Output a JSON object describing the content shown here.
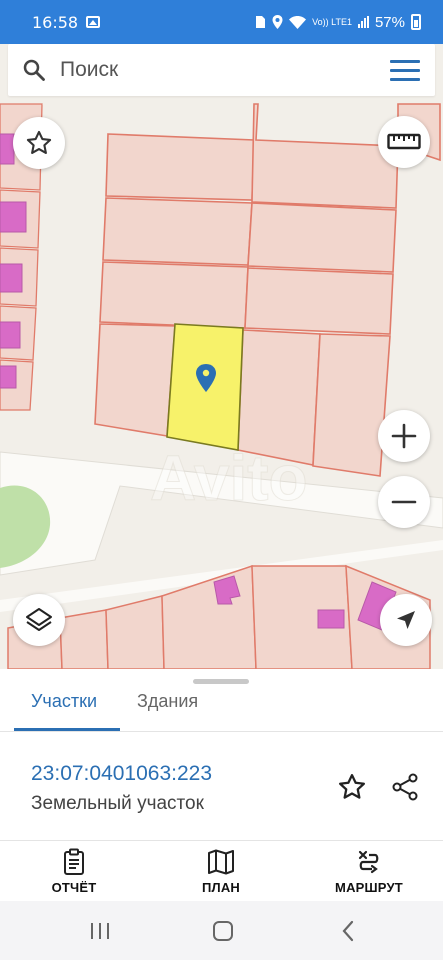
{
  "status_bar": {
    "time": "16:58",
    "network": "Vo)) LTE1",
    "battery": "57%"
  },
  "search": {
    "placeholder": "Поиск"
  },
  "map": {
    "watermark": "Avito",
    "colors": {
      "land": "#f2efe9",
      "plot_fill": "#f2d6cd",
      "plot_border": "#e07b6a",
      "selected_plot": "#f7f26a",
      "building": "#d86bc6",
      "green_area": "#bfe0a8",
      "road": "#fbfaf7",
      "marker": "#2b6fb3"
    },
    "icons": [
      "star-icon",
      "ruler-icon",
      "plus-icon",
      "minus-icon",
      "layers-icon",
      "navigate-icon",
      "map-pin-icon"
    ]
  },
  "tabs": [
    {
      "label": "Участки",
      "active": true
    },
    {
      "label": "Здания",
      "active": false
    }
  ],
  "parcel": {
    "cadastral_number": "23:07:0401063:223",
    "type": "Земельный участок"
  },
  "bottom_nav": [
    {
      "label": "ОТЧЁТ",
      "icon": "report-icon"
    },
    {
      "label": "ПЛАН",
      "icon": "map-icon"
    },
    {
      "label": "МАРШРУТ",
      "icon": "route-icon"
    }
  ],
  "accent_color": "#2b6fb3"
}
